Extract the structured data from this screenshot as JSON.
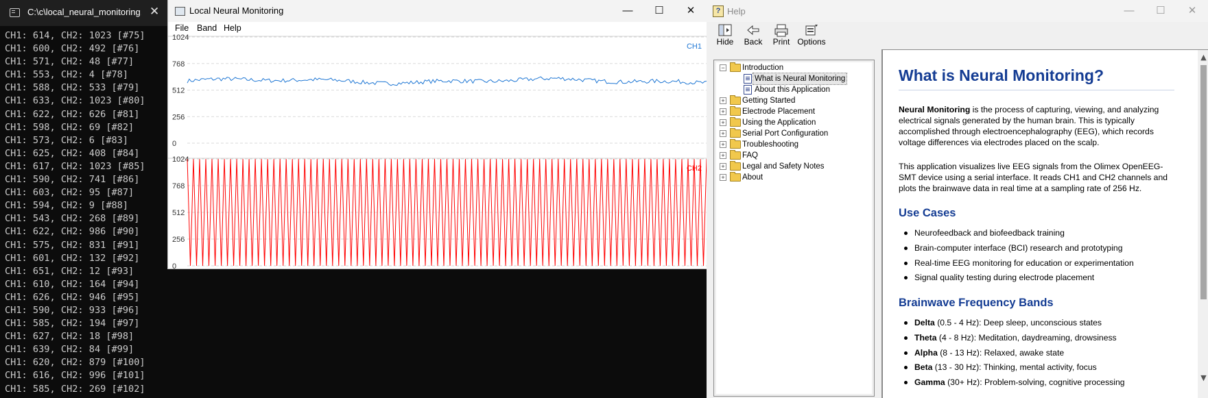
{
  "terminal": {
    "tab_title": "C:\\c\\local_neural_monitoring.",
    "close_glyph": "✕",
    "lines": [
      "CH1: 614, CH2: 1023 [#75]",
      "CH1: 600, CH2: 492 [#76]",
      "CH1: 571, CH2: 48 [#77]",
      "CH1: 553, CH2: 4 [#78]",
      "CH1: 588, CH2: 533 [#79]",
      "CH1: 633, CH2: 1023 [#80]",
      "CH1: 622, CH2: 626 [#81]",
      "CH1: 598, CH2: 69 [#82]",
      "CH1: 573, CH2: 6 [#83]",
      "CH1: 625, CH2: 408 [#84]",
      "CH1: 617, CH2: 1023 [#85]",
      "CH1: 590, CH2: 741 [#86]",
      "CH1: 603, CH2: 95 [#87]",
      "CH1: 594, CH2: 9 [#88]",
      "CH1: 543, CH2: 268 [#89]",
      "CH1: 622, CH2: 986 [#90]",
      "CH1: 575, CH2: 831 [#91]",
      "CH1: 601, CH2: 132 [#92]",
      "CH1: 651, CH2: 12 [#93]",
      "CH1: 610, CH2: 164 [#94]",
      "CH1: 626, CH2: 946 [#95]",
      "CH1: 590, CH2: 933 [#96]",
      "CH1: 585, CH2: 194 [#97]",
      "CH1: 627, CH2: 18 [#98]",
      "CH1: 639, CH2: 84 [#99]",
      "CH1: 620, CH2: 879 [#100]",
      "CH1: 616, CH2: 996 [#101]",
      "CH1: 585, CH2: 269 [#102]"
    ]
  },
  "plot_window": {
    "title": "Local Neural Monitoring",
    "menu": {
      "file": "File",
      "band": "Band",
      "help": "Help"
    },
    "caption": {
      "minimize": "—",
      "maximize": "☐",
      "close": "✕"
    }
  },
  "chart_data": [
    {
      "type": "line",
      "channel_label": "CH1",
      "ylim": [
        0,
        1024
      ],
      "yticks": [
        "0",
        "256",
        "512",
        "768",
        "1024"
      ],
      "color": "#1f77d4",
      "baseline": 600,
      "noise": 40
    },
    {
      "type": "line",
      "channel_label": "CH2",
      "ylim": [
        0,
        1024
      ],
      "yticks": [
        "0",
        "256",
        "512",
        "768",
        "1024"
      ],
      "color": "#ff0000",
      "min": 0,
      "max": 1023
    }
  ],
  "help_window": {
    "title": "Help",
    "icon_glyph": "?",
    "caption": {
      "minimize": "—",
      "maximize": "☐",
      "close": "✕"
    },
    "toolbar": {
      "hide": "Hide",
      "back": "Back",
      "print": "Print",
      "options": "Options"
    },
    "toc": {
      "introduction": "Introduction",
      "what_is": "What is Neural Monitoring",
      "about_app": "About this Application",
      "getting_started": "Getting Started",
      "electrode": "Electrode Placement",
      "using": "Using the Application",
      "serial": "Serial Port Configuration",
      "troubleshooting": "Troubleshooting",
      "faq": "FAQ",
      "legal": "Legal and Safety Notes",
      "about": "About"
    },
    "content": {
      "title": "What is Neural Monitoring?",
      "p1_bold": "Neural Monitoring",
      "p1_rest": " is the process of capturing, viewing, and analyzing electrical signals generated by the human brain. This is typically accomplished through electroencephalography (EEG), which records voltage differences via electrodes placed on the scalp.",
      "p2": "This application visualizes live EEG signals from the Olimex OpenEEG-SMT device using a serial interface. It reads CH1 and CH2 channels and plots the brainwave data in real time at a sampling rate of 256 Hz.",
      "use_cases_heading": "Use Cases",
      "use_cases": [
        "Neurofeedback and biofeedback training",
        "Brain-computer interface (BCI) research and prototyping",
        "Real-time EEG monitoring for education or experimentation",
        "Signal quality testing during electrode placement"
      ],
      "bands_heading": "Brainwave Frequency Bands",
      "bands": [
        {
          "name": "Delta",
          "range": " (0.5 - 4 Hz)",
          "desc": ": Deep sleep, unconscious states"
        },
        {
          "name": "Theta",
          "range": " (4 - 8 Hz)",
          "desc": ": Meditation, daydreaming, drowsiness"
        },
        {
          "name": "Alpha",
          "range": " (8 - 13 Hz)",
          "desc": ": Relaxed, awake state"
        },
        {
          "name": "Beta",
          "range": " (13 - 30 Hz)",
          "desc": ": Thinking, mental activity, focus"
        },
        {
          "name": "Gamma",
          "range": " (30+ Hz)",
          "desc": ": Problem-solving, cognitive processing"
        }
      ]
    }
  }
}
